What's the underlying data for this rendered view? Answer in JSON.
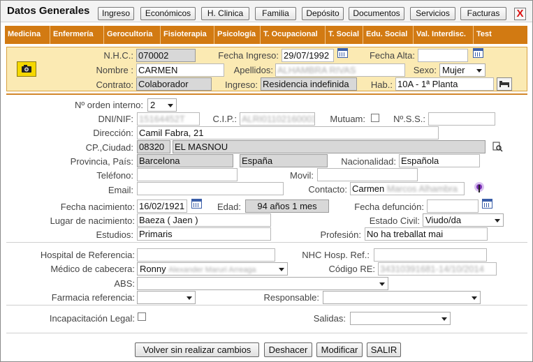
{
  "header": {
    "title": "Datos Generales",
    "tabs": [
      "Ingreso",
      "Económicos",
      "H. Clinica",
      "Familia",
      "Depósito",
      "Documentos",
      "Servicios",
      "Facturas"
    ],
    "close_label": "X"
  },
  "menu": [
    "Medicina",
    "Enfermería",
    "Gerocultoria",
    "Fisioterapia",
    "Psicología",
    "T. Ocupacional",
    "T. Social",
    "Edu. Social",
    "Val. Interdisc.",
    "Test"
  ],
  "resident": {
    "nhc_label": "N.H.C.:",
    "nhc": "070002",
    "fecha_ingreso_label": "Fecha Ingreso:",
    "fecha_ingreso": "29/07/1992",
    "fecha_alta_label": "Fecha Alta:",
    "fecha_alta": "",
    "nombre_label": "Nombre :",
    "nombre": "CARMEN",
    "apellidos_label": "Apellidos:",
    "apellidos": "ALHAMBRA RIVAS",
    "sexo_label": "Sexo:",
    "sexo": "Mujer",
    "contrato_label": "Contrato:",
    "contrato": "Colaborador",
    "ingreso_label": "Ingreso:",
    "ingreso": "Residencia indefinida",
    "hab_label": "Hab.:",
    "hab": "10A - 1ª Planta"
  },
  "form": {
    "orden_label": "Nº orden interno:",
    "orden": "2",
    "dni_label": "DNI/NIF:",
    "dni": "15164452T",
    "cip_label": "C.I.P.:",
    "cip": "ALRI01102160003",
    "mutuam_label": "Mutuam:",
    "nss_label": "Nº.S.S.:",
    "nss": "",
    "direccion_label": "Dirección:",
    "direccion": "Camil Fabra, 21",
    "cp_label": "CP.,Ciudad:",
    "cp": "08320",
    "ciudad": "EL MASNOU",
    "provincia_label": "Provincia, País:",
    "provincia": "Barcelona",
    "pais": "España",
    "nacionalidad_label": "Nacionalidad:",
    "nacionalidad": "Española",
    "telefono_label": "Teléfono:",
    "telefono": "",
    "movil_label": "Movil:",
    "movil": "",
    "email_label": "Email:",
    "email": "",
    "contacto_label": "Contacto:",
    "contacto_first": "Carmen",
    "contacto_rest": "Marcos Alhambra",
    "fnac_label": "Fecha nacimiento:",
    "fnac": "16/02/1921",
    "edad_label": "Edad:",
    "edad": "94 años 1 mes",
    "fdef_label": "Fecha defunción:",
    "fdef": "",
    "lugar_label": "Lugar de nacimiento:",
    "lugar": "Baeza ( Jaen )",
    "civil_label": "Estado Civil:",
    "civil": "Viudo/da",
    "estudios_label": "Estudios:",
    "estudios": "Primaris",
    "profesion_label": "Profesión:",
    "profesion": "No ha treballat mai",
    "hospital_label": "Hospital de Referencia:",
    "hospital": "",
    "nhc_hosp_label": "NHC Hosp. Ref.:",
    "nhc_hosp": "",
    "medico_label": "Médico de cabecera:",
    "medico_first": "Ronny",
    "medico_rest": "Alexander Maruri Arreaga",
    "codigo_label": "Código RE:",
    "codigo": "34310391681-14/10/2014",
    "abs_label": "ABS:",
    "abs": "",
    "farmacia_label": "Farmacia referencia:",
    "farmacia": "",
    "responsable_label": "Responsable:",
    "responsable": "",
    "incap_label": "Incapacitación Legal:",
    "salidas_label": "Salidas:",
    "salidas": ""
  },
  "footer": {
    "volver": "Volver sin realizar cambios",
    "deshacer": "Deshacer",
    "modificar": "Modificar",
    "salir": "SALIR"
  },
  "icons": [
    "camera-icon",
    "calendar-icon",
    "bed-icon",
    "search-document-icon",
    "contact-info-icon"
  ],
  "colors": {
    "menu_bg": "#d27a12",
    "header_bg": "#fbeab3",
    "accent_line": "#d2862a",
    "close": "#dd1111"
  }
}
